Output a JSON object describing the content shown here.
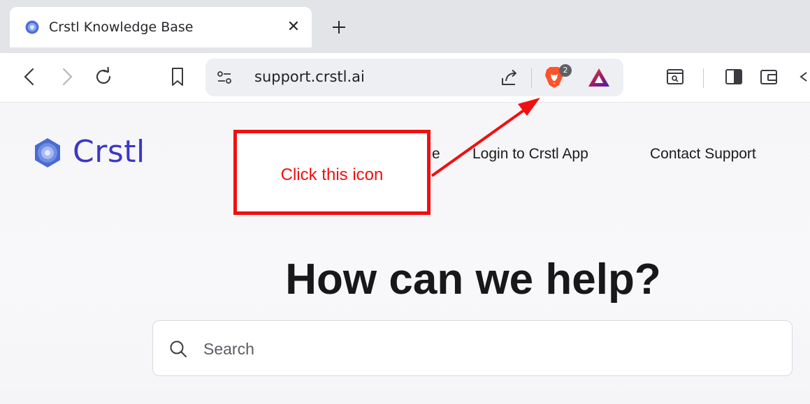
{
  "browser": {
    "tab": {
      "title": "Crstl Knowledge Base",
      "close_glyph": "✕"
    },
    "address_bar": {
      "url": "support.crstl.ai"
    },
    "shield_badge_count": "2"
  },
  "page": {
    "logo_text": "Crstl",
    "nav": {
      "item_partial": "e",
      "login": "Login to Crstl App",
      "contact": "Contact Support"
    },
    "hero_title": "How can we help?",
    "search": {
      "placeholder": "Search"
    }
  },
  "annotation": {
    "text": "Click this icon",
    "color": "#f20f0f"
  },
  "colors": {
    "brand": "#3b37c6",
    "annotation": "#f20f0f",
    "tabstrip": "#e3e4e8"
  }
}
